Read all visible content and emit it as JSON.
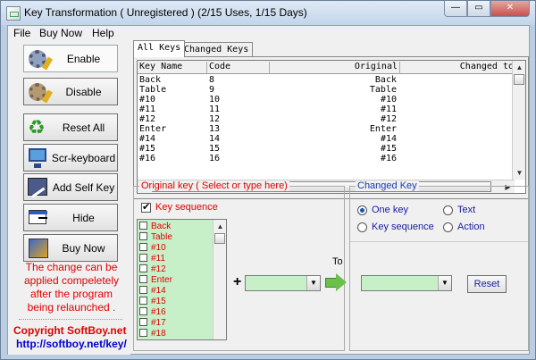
{
  "window": {
    "title": "Key Transformation ( Unregistered ) (2/15 Uses, 1/15 Days)",
    "minimize": "—",
    "maximize": "▭",
    "close": "✕"
  },
  "menu": [
    "File",
    "Buy Now",
    "Help"
  ],
  "left_buttons": [
    {
      "label": "Enable",
      "icon": "gear-pen-icon"
    },
    {
      "label": "Disable",
      "icon": "gear-disabled-icon"
    },
    {
      "label": "Reset All",
      "icon": "recycle-icon"
    },
    {
      "label": "Scr-keyboard",
      "icon": "monitor-icon"
    },
    {
      "label": "Add Self Key",
      "icon": "self-key-icon"
    },
    {
      "label": "Hide",
      "icon": "window-icon"
    },
    {
      "label": "Buy Now",
      "icon": "cart-icon"
    }
  ],
  "notice": "The change can be applied compeletely after the program being relaunched .",
  "copyright": "Copyright  SoftBoy.net",
  "url": "http://softboy.net/key/",
  "tabs": [
    "All Keys",
    "Changed Keys"
  ],
  "table": {
    "headers": [
      "Key Name",
      "Code",
      "Original",
      "Changed to"
    ],
    "rows": [
      [
        "Back",
        "8",
        "Back"
      ],
      [
        "Table",
        "9",
        "Table"
      ],
      [
        "#10",
        "10",
        "#10"
      ],
      [
        "#11",
        "11",
        "#11"
      ],
      [
        "#12",
        "12",
        "#12"
      ],
      [
        "Enter",
        "13",
        "Enter"
      ],
      [
        "#14",
        "14",
        "#14"
      ],
      [
        "#15",
        "15",
        "#15"
      ],
      [
        "#16",
        "16",
        "#16"
      ]
    ]
  },
  "original_key": {
    "title": "Original key ( Select or type here)",
    "key_sequence_label": "Key sequence",
    "key_sequence_checked": true,
    "list_items": [
      "Back",
      "Table",
      "#10",
      "#11",
      "#12",
      "Enter",
      "#14",
      "#15",
      "#16",
      "#17",
      "#18"
    ],
    "plus": "+"
  },
  "to_label": "To",
  "changed_key": {
    "title": "Changed Key",
    "options": [
      {
        "label": "One key",
        "selected": true
      },
      {
        "label": "Text",
        "selected": false
      },
      {
        "label": "Key sequence",
        "selected": false
      },
      {
        "label": "Action",
        "selected": false
      }
    ],
    "reset_label": "Reset"
  }
}
